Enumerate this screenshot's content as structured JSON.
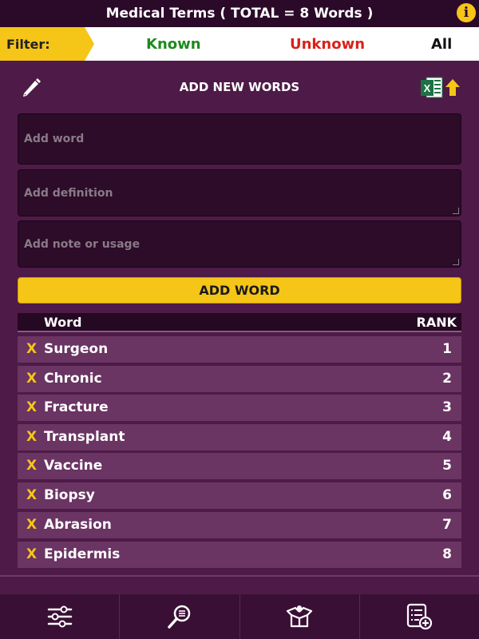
{
  "header": {
    "title": "Medical Terms ( TOTAL = 8 Words )",
    "info_icon": "info-icon"
  },
  "filter": {
    "label": "Filter:",
    "known": "Known",
    "unknown": "Unknown",
    "all": "All",
    "known_color": "#1e8a1e",
    "unknown_color": "#d9211a"
  },
  "add_section": {
    "title": "ADD NEW WORDS",
    "word_placeholder": "Add word",
    "definition_placeholder": "Add definition",
    "note_placeholder": "Add note or usage",
    "button_label": "ADD WORD",
    "icons": [
      "pencil-icon",
      "excel-import-icon"
    ]
  },
  "table": {
    "header_word": "Word",
    "header_rank": "RANK",
    "delete_symbol": "X",
    "rows": [
      {
        "word": "Surgeon",
        "rank": "1"
      },
      {
        "word": "Chronic",
        "rank": "2"
      },
      {
        "word": "Fracture",
        "rank": "3"
      },
      {
        "word": "Transplant",
        "rank": "4"
      },
      {
        "word": "Vaccine",
        "rank": "5"
      },
      {
        "word": "Biopsy",
        "rank": "6"
      },
      {
        "word": "Abrasion",
        "rank": "7"
      },
      {
        "word": "Epidermis",
        "rank": "8"
      }
    ]
  },
  "bottom_nav": {
    "tabs": [
      {
        "icon": "sliders-icon"
      },
      {
        "icon": "search-list-icon"
      },
      {
        "icon": "open-box-icon"
      },
      {
        "icon": "add-list-icon"
      }
    ]
  },
  "colors": {
    "background": "#4e1a47",
    "accent": "#f5c518",
    "header": "#2b0a29",
    "row": "#6a3463"
  }
}
